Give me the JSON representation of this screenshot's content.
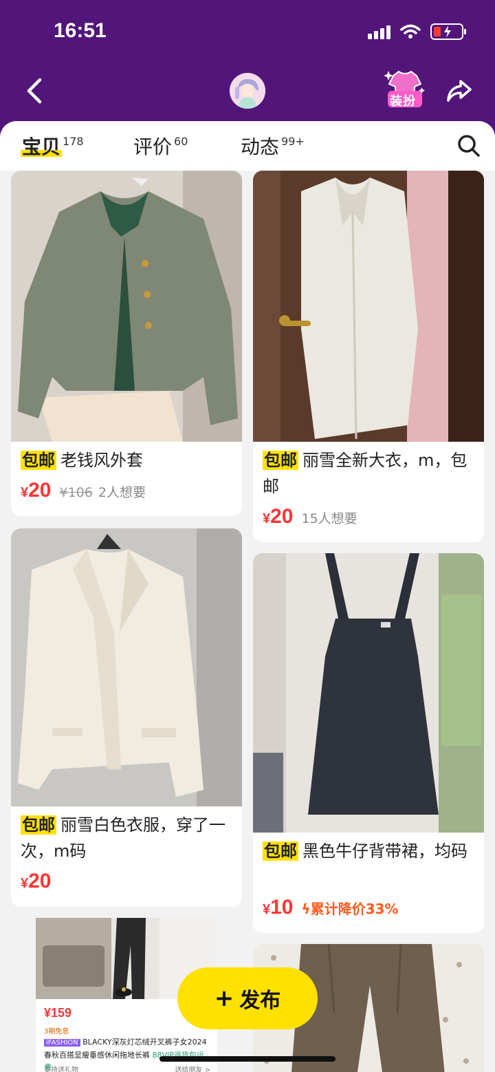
{
  "status": {
    "time": "16:51"
  },
  "header": {
    "dressup_label": "装扮"
  },
  "tabs": [
    {
      "label": "宝贝",
      "count": "178"
    },
    {
      "label": "评价",
      "count": "60"
    },
    {
      "label": "动态",
      "count": "99+"
    }
  ],
  "items": [
    {
      "tag": "包邮",
      "title": "老钱风外套",
      "price": "20",
      "currency": "¥",
      "original_price": "¥106",
      "want": "2人想要"
    },
    {
      "tag": "包邮",
      "title": "丽雪全新大衣，m，包邮",
      "price": "20",
      "currency": "¥",
      "want": "15人想要"
    },
    {
      "tag": "包邮",
      "title": "丽雪白色衣服，穿了一次，m码",
      "price": "20",
      "currency": "¥"
    },
    {
      "tag": "包邮",
      "title": "黑色牛仔背带裙，均码",
      "price": "10",
      "currency": "¥",
      "drop": "累计降价33%"
    }
  ],
  "ad": {
    "price": "¥159",
    "installment": "3期免息",
    "brand": "iFASHION",
    "text": "BLACKY深灰灯芯绒开叉裤子女2024春秋百搭显瘦垂感休闲拖地长裤",
    "vip": "88VIP退货包运费",
    "gift": "支持送礼物",
    "friend": "送给朋友 >"
  },
  "publish": {
    "label": "发布"
  },
  "colors": {
    "header": "#52167a",
    "accent": "#ffe100",
    "price": "#ff3535"
  }
}
